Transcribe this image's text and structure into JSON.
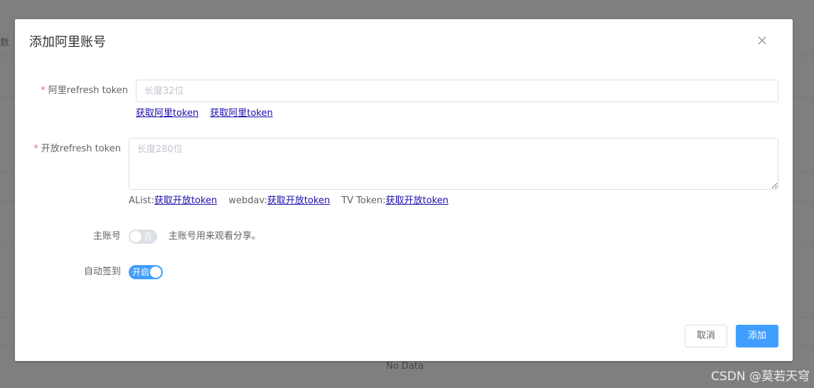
{
  "background": {
    "left_edge_text": "数",
    "empty_text": "No Data"
  },
  "dialog": {
    "title": "添加阿里账号",
    "close_icon": "close-icon"
  },
  "form": {
    "required_mark": "*",
    "ali_token": {
      "label": "阿里refresh token",
      "placeholder": "长度32位",
      "value": "",
      "links": [
        "获取阿里token",
        "获取阿里token"
      ]
    },
    "open_token": {
      "label": "开放refresh token",
      "placeholder": "长度280位",
      "value": "",
      "links": [
        {
          "prefix": "AList:",
          "text": "获取开放token"
        },
        {
          "prefix": "webdav:",
          "text": "获取开放token"
        },
        {
          "prefix": "TV Token:",
          "text": "获取开放token"
        }
      ]
    },
    "main_account": {
      "label": "主账号",
      "switch_text": "否",
      "checked": false,
      "hint": "主账号用来观看分享。"
    },
    "auto_checkin": {
      "label": "自动签到",
      "switch_text": "开启",
      "checked": true
    }
  },
  "footer": {
    "cancel_label": "取消",
    "submit_label": "添加"
  },
  "watermark": "CSDN @莫若天穹",
  "colors": {
    "primary": "#409eff",
    "required": "#f56c6c",
    "link": "#1a0dab",
    "overlay": "rgba(0,0,0,0.5)"
  }
}
